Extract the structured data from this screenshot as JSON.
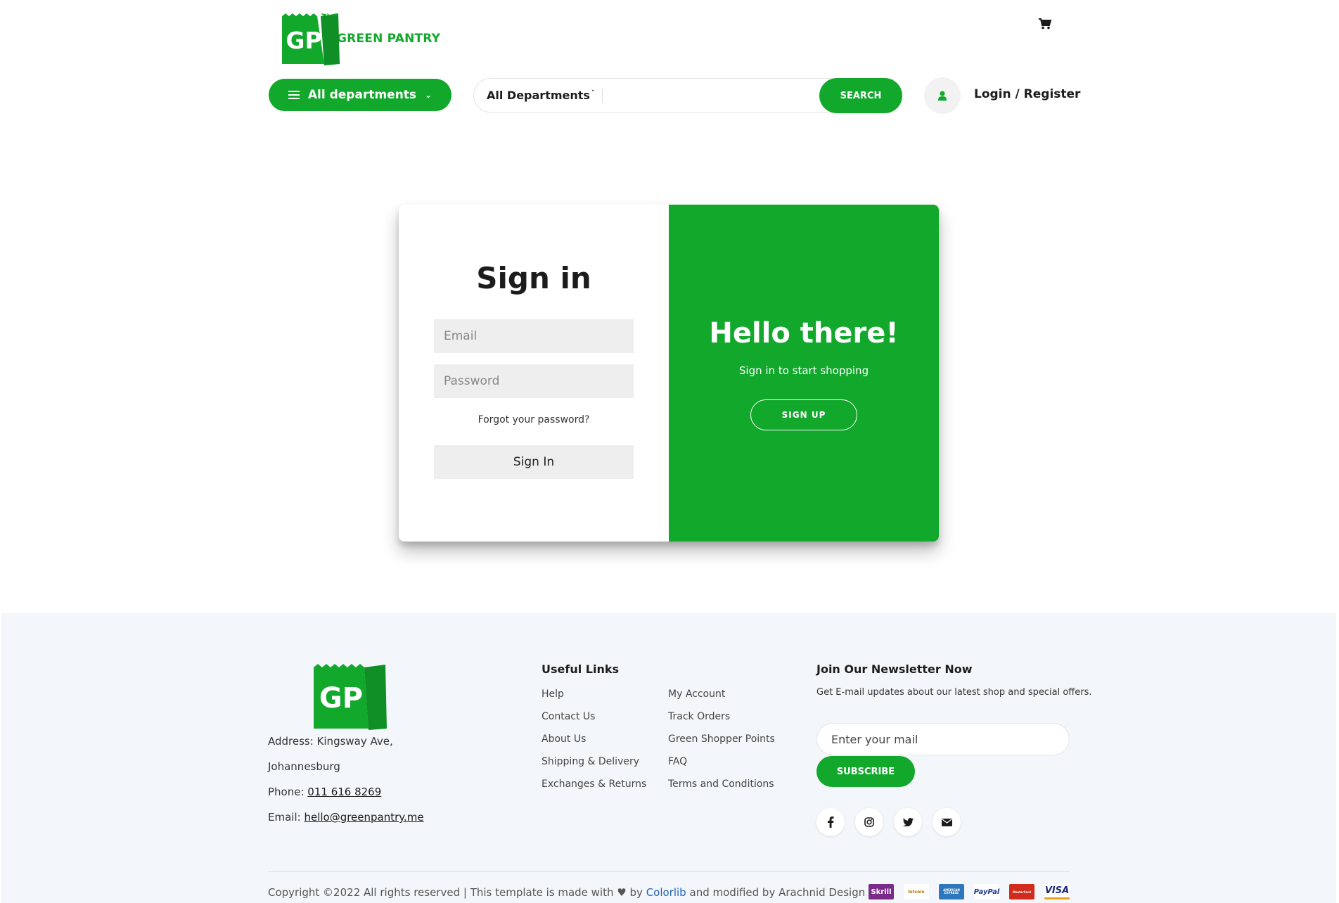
{
  "header": {
    "brand_initials": "GP",
    "brand_name": "GREEN PANTRY",
    "all_departments_label": "All departments",
    "search_category": "All Departments",
    "search_placeholder": "",
    "search_button": "SEARCH",
    "login_label": "Login / Register"
  },
  "signin": {
    "title": "Sign in",
    "email_placeholder": "Email",
    "password_placeholder": "Password",
    "forgot_label": "Forgot your password?",
    "submit_label": "Sign In"
  },
  "welcome_panel": {
    "title": "Hello there!",
    "subtitle": "Sign in to start shopping",
    "signup_label": "SIGN UP"
  },
  "footer": {
    "brand_initials": "GP",
    "address_line1": "Address: Kingsway Ave,",
    "address_line2": "Johannesburg",
    "phone_prefix": "Phone: ",
    "phone": "011 616 8269",
    "email_prefix": "Email: ",
    "email": "hello@greenpantry.me",
    "useful_links_heading": "Useful Links",
    "links_col1": [
      "Help",
      "Contact Us",
      "About Us",
      "Shipping & Delivery",
      "Exchanges & Returns"
    ],
    "links_col2": [
      "My Account",
      "Track Orders",
      "Green Shopper Points",
      "FAQ",
      "Terms and Conditions"
    ],
    "newsletter_heading": "Join Our Newsletter Now",
    "newsletter_text": "Get E-mail updates about our latest shop and special offers.",
    "newsletter_placeholder": "Enter your mail",
    "subscribe_label": "SUBSCRIBE",
    "social_icons": [
      "facebook-icon",
      "instagram-icon",
      "twitter-icon",
      "envelope-icon"
    ],
    "copyright_pre": "Copyright ©2022 All rights reserved | This template is made with",
    "copyright_by": "by",
    "copyright_brand": "Colorlib",
    "copyright_post": "and modified by Arachnid Design",
    "payment_methods": [
      "Skrill",
      "bitcoin",
      "AMERICAN EXPRESS",
      "PayPal",
      "MasterCard",
      "VISA"
    ]
  },
  "colors": {
    "brand_green": "#12a82c",
    "footer_bg": "#f3f6fa",
    "link_blue": "#2266bb"
  }
}
